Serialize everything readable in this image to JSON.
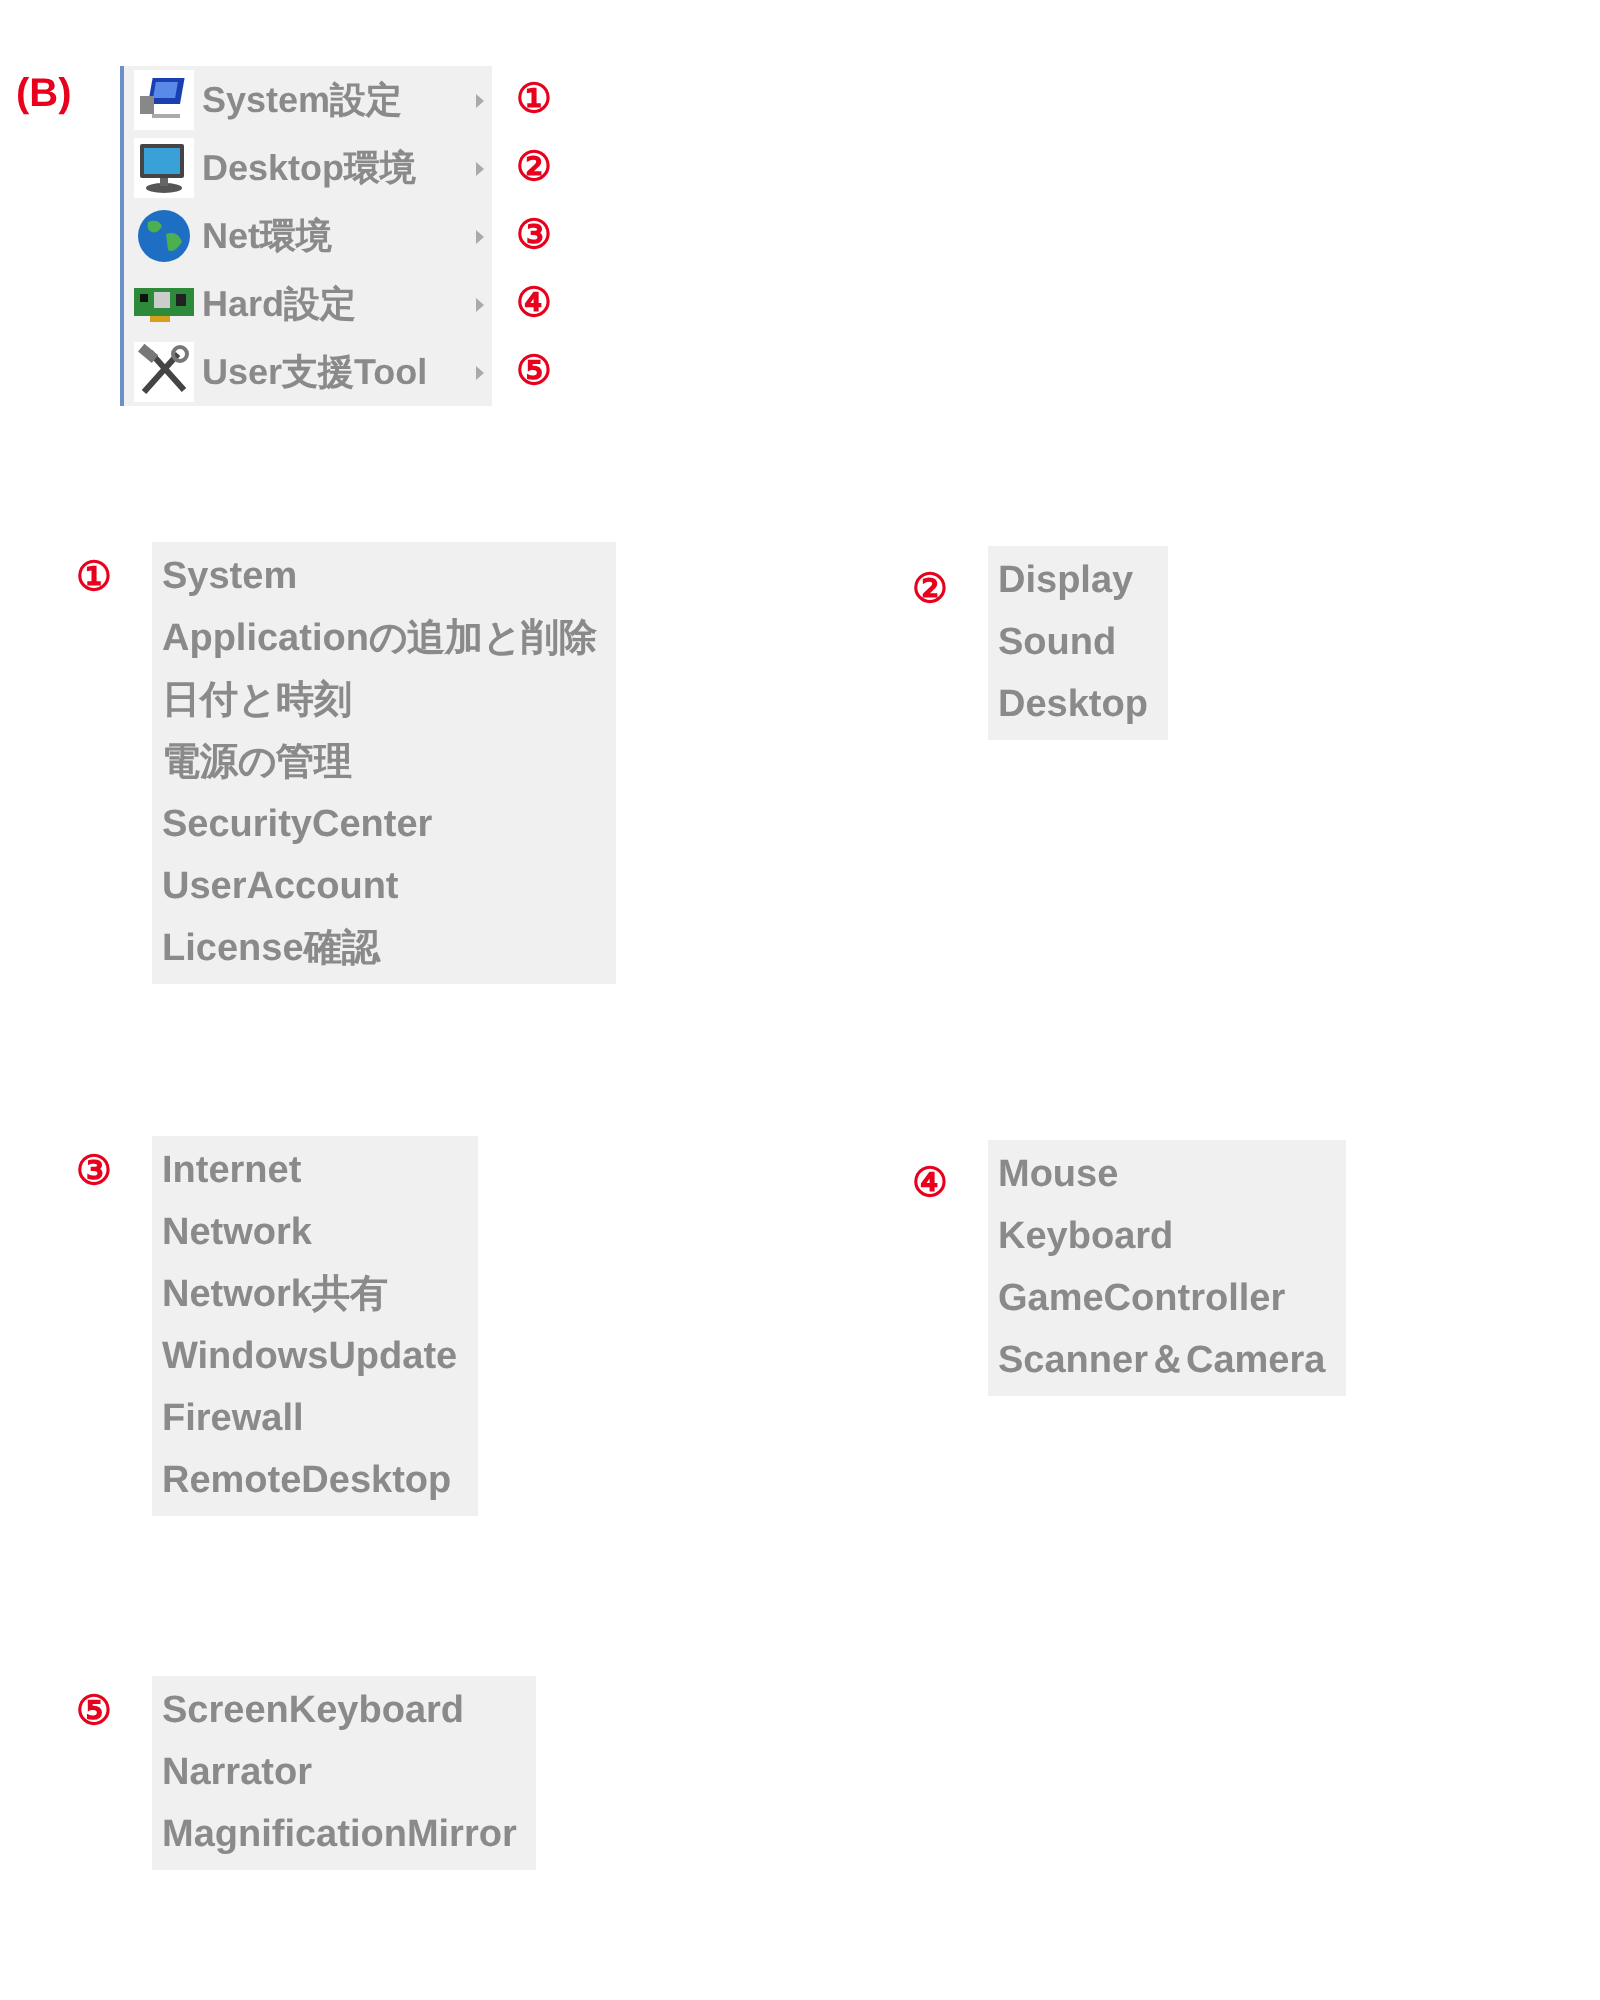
{
  "figure_label": "(B)",
  "menu": {
    "items": [
      {
        "label": "System設定",
        "marker": "①"
      },
      {
        "label": "Desktop環境",
        "marker": "②"
      },
      {
        "label": "Net環境",
        "marker": "③"
      },
      {
        "label": "Hard設定",
        "marker": "④"
      },
      {
        "label": "User支援Tool",
        "marker": "⑤"
      }
    ]
  },
  "submenus": [
    {
      "marker": "①",
      "items": [
        "System",
        "Applicationの追加と削除",
        "日付と時刻",
        "電源の管理",
        "SecurityCenter",
        "UserAccount",
        "License確認"
      ]
    },
    {
      "marker": "②",
      "items": [
        "Display",
        "Sound",
        "Desktop"
      ]
    },
    {
      "marker": "③",
      "items": [
        "Internet",
        "Network",
        "Network共有",
        "WindowsUpdate",
        "Firewall",
        "RemoteDesktop"
      ]
    },
    {
      "marker": "④",
      "items": [
        "Mouse",
        "Keyboard",
        "GameController",
        "Scanner＆Camera"
      ]
    },
    {
      "marker": "⑤",
      "items": [
        "ScreenKeyboard",
        "Narrator",
        "MagnificationMirror"
      ]
    }
  ]
}
